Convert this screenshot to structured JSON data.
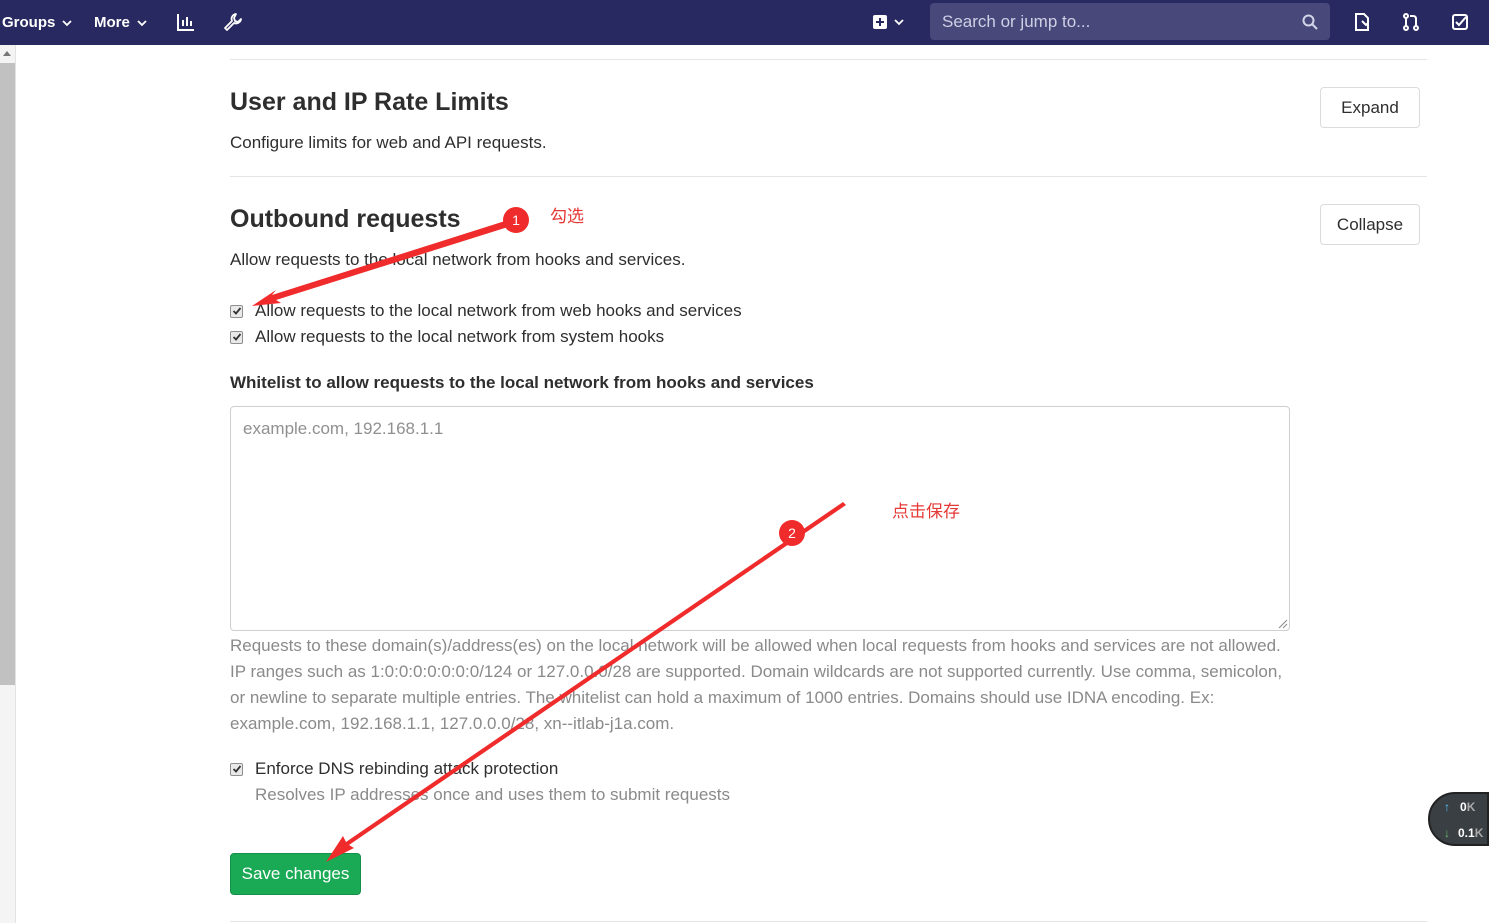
{
  "topbar": {
    "groups_label": "Groups",
    "more_label": "More",
    "search_placeholder": "Search or jump to..."
  },
  "rate_limits": {
    "title": "User and IP Rate Limits",
    "description": "Configure limits for web and API requests.",
    "button_label": "Expand"
  },
  "outbound": {
    "title": "Outbound requests",
    "description": "Allow requests to the local network from hooks and services.",
    "button_label": "Collapse",
    "checkbox_web_hooks": {
      "label": "Allow requests to the local network from web hooks and services",
      "checked": true
    },
    "checkbox_system_hooks": {
      "label": "Allow requests to the local network from system hooks",
      "checked": true
    },
    "whitelist_label": "Whitelist to allow requests to the local network from hooks and services",
    "whitelist_placeholder": "example.com, 192.168.1.1",
    "whitelist_value": "",
    "whitelist_help": "Requests to these domain(s)/address(es) on the local network will be allowed when local requests from hooks and services are not allowed. IP ranges such as 1:0:0:0:0:0:0:0/124 or 127.0.0.0/28 are supported. Domain wildcards are not supported currently. Use comma, semicolon, or newline to separate multiple entries. The whitelist can hold a maximum of 1000 entries. Domains should use IDNA encoding. Ex: example.com, 192.168.1.1, 127.0.0.0/28, xn--itlab-j1a.com.",
    "dns_rebinding": {
      "label": "Enforce DNS rebinding attack protection",
      "help": "Resolves IP addresses once and uses them to submit requests",
      "checked": true
    },
    "save_label": "Save changes"
  },
  "annotations": {
    "step1_number": "1",
    "step1_text": "勾选",
    "step2_number": "2",
    "step2_text": "点击保存",
    "color": "#e53935"
  },
  "net_widget": {
    "up_value": "0",
    "up_unit": "K",
    "down_value": "0.1",
    "down_unit": "K"
  },
  "colors": {
    "navbar": "#292961",
    "save_button": "#1aaa55",
    "annotation": "#ef2b2b"
  }
}
